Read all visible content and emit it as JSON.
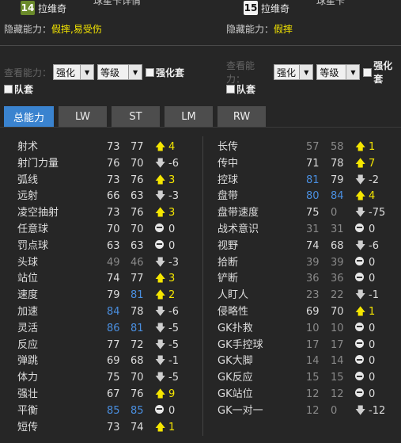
{
  "header": {
    "left": {
      "badge": "14",
      "name": "拉维奇",
      "cut_text": "球星卡详情"
    },
    "right": {
      "badge": "15",
      "name": "拉维奇",
      "cut_text": "球星卡"
    }
  },
  "hidden_ability": {
    "left": {
      "label": "隐藏能力：",
      "value": "假摔,易受伤"
    },
    "right": {
      "label": "隐藏能力：",
      "value": "假摔"
    }
  },
  "view": {
    "label": "查看能力：",
    "select1": "强化",
    "select2": "等级",
    "check_boost": "强化套",
    "check_team": "队套"
  },
  "tabs": [
    "总能力",
    "LW",
    "ST",
    "LM",
    "RW"
  ],
  "colors": {
    "up_arrow": "#f5e600",
    "blue_value": "#4a8fe0",
    "tab_active": "#3a83cf"
  },
  "stats_left": [
    {
      "name": "射术",
      "a": "73",
      "b": "77",
      "dir": "up",
      "diff": "4"
    },
    {
      "name": "射门力量",
      "a": "76",
      "b": "70",
      "dir": "down",
      "diff": "-6"
    },
    {
      "name": "弧线",
      "a": "73",
      "b": "76",
      "dir": "up",
      "diff": "3"
    },
    {
      "name": "远射",
      "a": "66",
      "b": "63",
      "dir": "down",
      "diff": "-3"
    },
    {
      "name": "凌空抽射",
      "a": "73",
      "b": "76",
      "dir": "up",
      "diff": "3"
    },
    {
      "name": "任意球",
      "a": "70",
      "b": "70",
      "dir": "zero",
      "diff": "0"
    },
    {
      "name": "罚点球",
      "a": "63",
      "b": "63",
      "dir": "zero",
      "diff": "0"
    },
    {
      "name": "头球",
      "a": "49",
      "b": "46",
      "dir": "down",
      "diff": "-3",
      "ac": "dim",
      "bc": "dim"
    },
    {
      "name": "站位",
      "a": "74",
      "b": "77",
      "dir": "up",
      "diff": "3"
    },
    {
      "name": "速度",
      "a": "79",
      "b": "81",
      "dir": "up",
      "diff": "2",
      "bc": "blue"
    },
    {
      "name": "加速",
      "a": "84",
      "b": "78",
      "dir": "down",
      "diff": "-6",
      "ac": "blue"
    },
    {
      "name": "灵活",
      "a": "86",
      "b": "81",
      "dir": "down",
      "diff": "-5",
      "ac": "blue",
      "bc": "blue"
    },
    {
      "name": "反应",
      "a": "77",
      "b": "72",
      "dir": "down",
      "diff": "-5"
    },
    {
      "name": "弹跳",
      "a": "69",
      "b": "68",
      "dir": "down",
      "diff": "-1"
    },
    {
      "name": "体力",
      "a": "75",
      "b": "70",
      "dir": "down",
      "diff": "-5"
    },
    {
      "name": "强壮",
      "a": "67",
      "b": "76",
      "dir": "up",
      "diff": "9"
    },
    {
      "name": "平衡",
      "a": "85",
      "b": "85",
      "dir": "zero",
      "diff": "0",
      "ac": "blue",
      "bc": "blue"
    },
    {
      "name": "短传",
      "a": "73",
      "b": "74",
      "dir": "up",
      "diff": "1"
    }
  ],
  "stats_right": [
    {
      "name": "长传",
      "a": "57",
      "b": "58",
      "dir": "up",
      "diff": "1",
      "ac": "dim",
      "bc": "dim"
    },
    {
      "name": "传中",
      "a": "71",
      "b": "78",
      "dir": "up",
      "diff": "7"
    },
    {
      "name": "控球",
      "a": "81",
      "b": "79",
      "dir": "down",
      "diff": "-2",
      "ac": "blue"
    },
    {
      "name": "盘带",
      "a": "80",
      "b": "84",
      "dir": "up",
      "diff": "4",
      "ac": "blue",
      "bc": "blue"
    },
    {
      "name": "盘带速度",
      "a": "75",
      "b": "0",
      "dir": "down",
      "diff": "-75",
      "bc": "dim"
    },
    {
      "name": "战术意识",
      "a": "31",
      "b": "31",
      "dir": "zero",
      "diff": "0",
      "ac": "dim",
      "bc": "dim"
    },
    {
      "name": "视野",
      "a": "74",
      "b": "68",
      "dir": "down",
      "diff": "-6"
    },
    {
      "name": "拾断",
      "a": "39",
      "b": "39",
      "dir": "zero",
      "diff": "0",
      "ac": "dim",
      "bc": "dim"
    },
    {
      "name": "铲断",
      "a": "36",
      "b": "36",
      "dir": "zero",
      "diff": "0",
      "ac": "dim",
      "bc": "dim"
    },
    {
      "name": "人盯人",
      "a": "23",
      "b": "22",
      "dir": "down",
      "diff": "-1",
      "ac": "dim",
      "bc": "dim"
    },
    {
      "name": "侵略性",
      "a": "69",
      "b": "70",
      "dir": "up",
      "diff": "1"
    },
    {
      "name": "GK扑救",
      "a": "10",
      "b": "10",
      "dir": "zero",
      "diff": "0",
      "ac": "dim",
      "bc": "dim"
    },
    {
      "name": "GK手控球",
      "a": "17",
      "b": "17",
      "dir": "zero",
      "diff": "0",
      "ac": "dim",
      "bc": "dim"
    },
    {
      "name": "GK大脚",
      "a": "14",
      "b": "14",
      "dir": "zero",
      "diff": "0",
      "ac": "dim",
      "bc": "dim"
    },
    {
      "name": "GK反应",
      "a": "15",
      "b": "15",
      "dir": "zero",
      "diff": "0",
      "ac": "dim",
      "bc": "dim"
    },
    {
      "name": "GK站位",
      "a": "12",
      "b": "12",
      "dir": "zero",
      "diff": "0",
      "ac": "dim",
      "bc": "dim"
    },
    {
      "name": "GK一对一",
      "a": "12",
      "b": "0",
      "dir": "down",
      "diff": "-12",
      "ac": "dim",
      "bc": "dim"
    }
  ]
}
